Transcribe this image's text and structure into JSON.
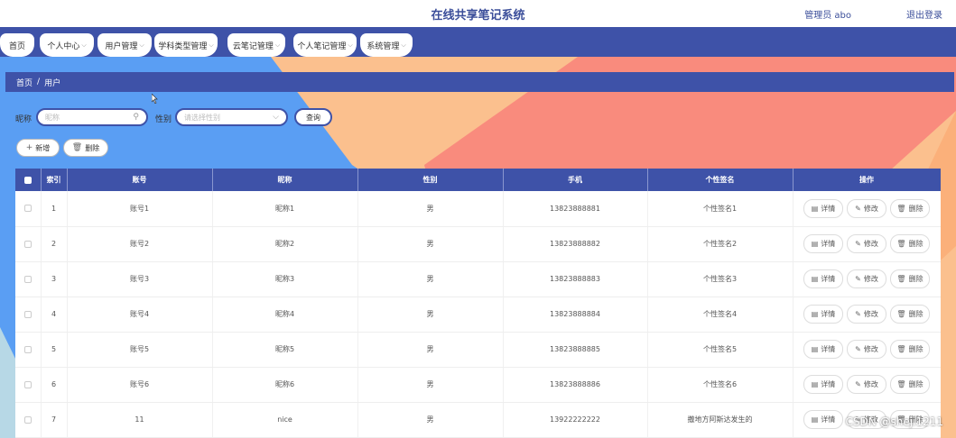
{
  "header": {
    "title": "在线共享笔记系统",
    "user": "管理员 abo",
    "logout": "退出登录"
  },
  "nav": [
    {
      "label": "首页",
      "chevron": false
    },
    {
      "label": "个人中心",
      "chevron": true
    },
    {
      "label": "用户管理",
      "chevron": true
    },
    {
      "label": "学科类型管理",
      "chevron": true
    },
    {
      "label": "云笔记管理",
      "chevron": true
    },
    {
      "label": "个人笔记管理",
      "chevron": true
    },
    {
      "label": "系统管理",
      "chevron": true
    }
  ],
  "breadcrumb": {
    "home": "首页",
    "separator": "/",
    "current": "用户"
  },
  "search": {
    "nickname_label": "昵称",
    "nickname_placeholder": "昵称",
    "gender_label": "性别",
    "gender_placeholder": "请选择性别",
    "query_button": "查询"
  },
  "toolbar": {
    "add": "新增",
    "delete": "删除"
  },
  "table": {
    "headers": [
      "索引",
      "账号",
      "昵称",
      "性别",
      "手机",
      "个性签名",
      "操作"
    ],
    "actions": {
      "detail": "详情",
      "edit": "修改",
      "delete": "删除"
    },
    "rows": [
      {
        "index": "1",
        "account": "账号1",
        "nickname": "昵称1",
        "gender": "男",
        "phone": "13823888881",
        "signature": "个性签名1"
      },
      {
        "index": "2",
        "account": "账号2",
        "nickname": "昵称2",
        "gender": "男",
        "phone": "13823888882",
        "signature": "个性签名2"
      },
      {
        "index": "3",
        "account": "账号3",
        "nickname": "昵称3",
        "gender": "男",
        "phone": "13823888883",
        "signature": "个性签名3"
      },
      {
        "index": "4",
        "account": "账号4",
        "nickname": "昵称4",
        "gender": "男",
        "phone": "13823888884",
        "signature": "个性签名4"
      },
      {
        "index": "5",
        "account": "账号5",
        "nickname": "昵称5",
        "gender": "男",
        "phone": "13823888885",
        "signature": "个性签名5"
      },
      {
        "index": "6",
        "account": "账号6",
        "nickname": "昵称6",
        "gender": "男",
        "phone": "13823888886",
        "signature": "个性签名6"
      },
      {
        "index": "7",
        "account": "11",
        "nickname": "nice",
        "gender": "男",
        "phone": "13922222222",
        "signature": "撒地方阿斯达发生的"
      }
    ]
  },
  "watermark": "CSDN @sheji1211",
  "colors": {
    "primary": "#3e52a8",
    "orange": "#fbc08e",
    "salmon": "#f98b7d",
    "blue": "#5a9ef3"
  }
}
